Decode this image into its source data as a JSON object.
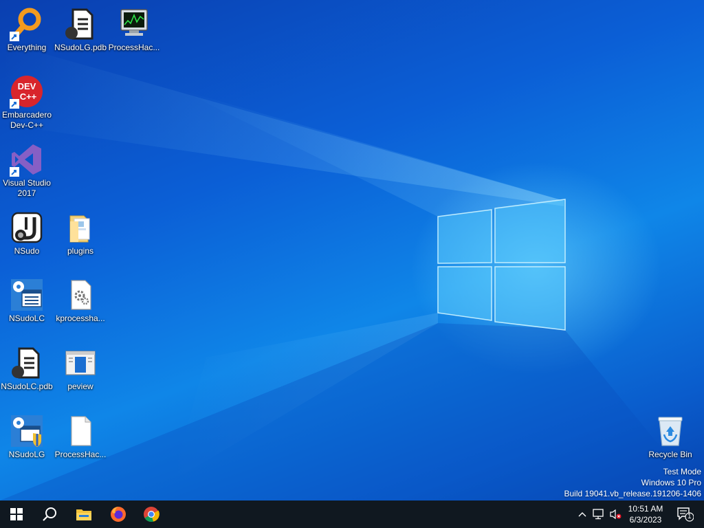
{
  "desktop": {
    "icons": [
      {
        "label": "Everything"
      },
      {
        "label": "NSudoLG.pdb"
      },
      {
        "label": "ProcessHac..."
      },
      {
        "label": "Embarcadero Dev-C++"
      },
      {
        "label": "Visual Studio 2017"
      },
      {
        "label": "NSudo"
      },
      {
        "label": "plugins"
      },
      {
        "label": "NSudoLC"
      },
      {
        "label": "kprocessha..."
      },
      {
        "label": "NSudoLC.pdb"
      },
      {
        "label": "peview"
      },
      {
        "label": "NSudoLG"
      },
      {
        "label": "ProcessHac..."
      },
      {
        "label": "Recycle Bin"
      }
    ],
    "devcpp_logo": {
      "line1": "DEV",
      "line2": "C++"
    }
  },
  "watermark": {
    "line1": "Test Mode",
    "line2": "Windows 10 Pro",
    "line3": "Build 19041.vb_release.191206-1406"
  },
  "taskbar": {
    "apps": [
      "start-icon",
      "search-icon",
      "file-explorer-icon",
      "firefox-icon",
      "chrome-icon"
    ],
    "tray": {
      "time": "10:51 AM",
      "date": "6/3/2023",
      "notification_count": "1"
    }
  },
  "colors": {
    "taskbar": "#101820",
    "desktop_accent": "#0f86e8"
  }
}
